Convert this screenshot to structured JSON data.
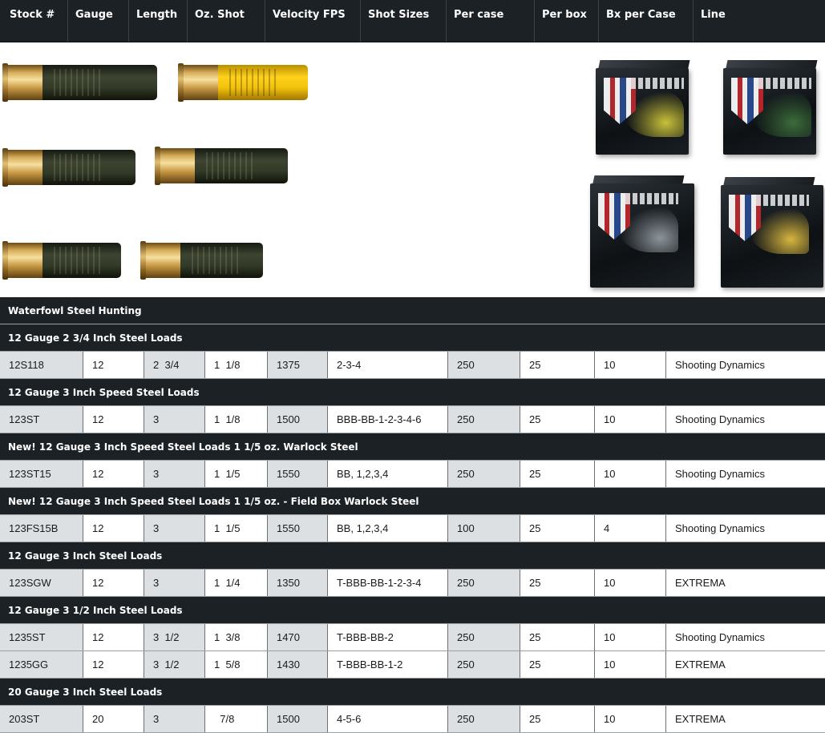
{
  "header": {
    "columns": [
      "Stock #",
      "Gauge",
      "Length",
      "Oz. Shot",
      "Velocity FPS",
      "Shot Sizes",
      "Per case",
      "Per box",
      "Bx per Case",
      "Line"
    ]
  },
  "boxes": [
    {
      "brand": "FIOCCHI",
      "accent": "#c9c13a"
    },
    {
      "brand": "FIOCCHI",
      "accent": "#3b6c3a"
    },
    {
      "brand": "FIOCCHI",
      "accent": "#8d959c"
    },
    {
      "brand": "FIOCCHI",
      "accent": "#d7b640"
    }
  ],
  "colors": {
    "header_bg": "#1b2125",
    "row_shade": "#dde0e3",
    "brass": "#d8ae5c",
    "green_hull": "#3d4531",
    "yellow_hull": "#ffd21c"
  },
  "table": {
    "sections": [
      {
        "title": "Waterfowl Steel Hunting",
        "rows": []
      },
      {
        "title": "12 Gauge 2 3/4 Inch Steel Loads",
        "rows": [
          [
            "12S118",
            "12",
            "2  3/4",
            "1  1/8",
            "1375",
            "2-3-4",
            "250",
            "25",
            "10",
            "Shooting Dynamics"
          ]
        ]
      },
      {
        "title": "12 Gauge 3 Inch Speed Steel Loads",
        "rows": [
          [
            "123ST",
            "12",
            "3",
            "1  1/8",
            "1500",
            "BBB-BB-1-2-3-4-6",
            "250",
            "25",
            "10",
            "Shooting Dynamics"
          ]
        ]
      },
      {
        "title": "New! 12 Gauge 3 Inch Speed Steel Loads 1 1/5 oz. Warlock Steel",
        "rows": [
          [
            "123ST15",
            "12",
            "3",
            "1  1/5",
            "1550",
            "BB, 1,2,3,4",
            "250",
            "25",
            "10",
            "Shooting Dynamics"
          ]
        ]
      },
      {
        "title": "New! 12 Gauge 3 Inch Speed Steel Loads 1 1/5 oz. - Field Box Warlock Steel",
        "rows": [
          [
            "123FS15B",
            "12",
            "3",
            "1  1/5",
            "1550",
            "BB, 1,2,3,4",
            "100",
            "25",
            "4",
            "Shooting Dynamics"
          ]
        ]
      },
      {
        "title": "12 Gauge 3 Inch Steel Loads",
        "rows": [
          [
            "123SGW",
            "12",
            "3",
            "1  1/4",
            "1350",
            "T-BBB-BB-1-2-3-4",
            "250",
            "25",
            "10",
            "EXTREMA"
          ]
        ]
      },
      {
        "title": "12 Gauge 3 1/2 Inch Steel Loads",
        "rows": [
          [
            "1235ST",
            "12",
            "3  1/2",
            "1  3/8",
            "1470",
            "T-BBB-BB-2",
            "250",
            "25",
            "10",
            "Shooting Dynamics"
          ],
          [
            "1235GG",
            "12",
            "3  1/2",
            "1  5/8",
            "1430",
            "T-BBB-BB-1-2",
            "250",
            "25",
            "10",
            "EXTREMA"
          ]
        ]
      },
      {
        "title": "20 Gauge 3 Inch Steel Loads",
        "rows": [
          [
            "203ST",
            "20",
            "3",
            "  7/8",
            "1500",
            "4-5-6",
            "250",
            "25",
            "10",
            "EXTREMA"
          ]
        ]
      }
    ]
  }
}
